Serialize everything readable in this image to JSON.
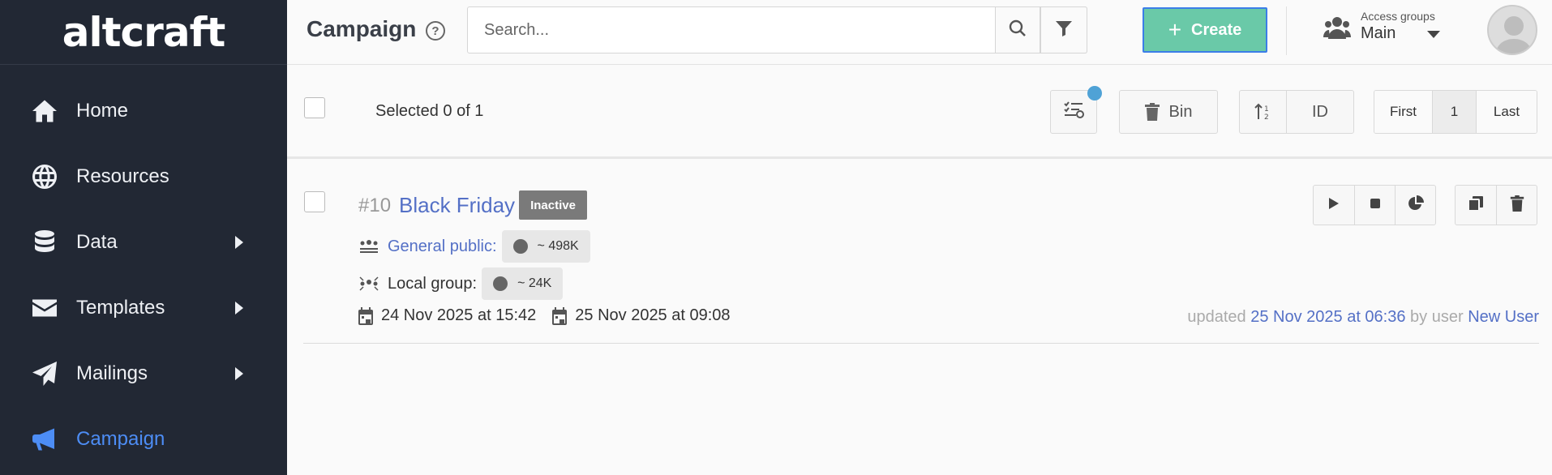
{
  "brand": {
    "logo": "altcraft"
  },
  "sidebar": {
    "items": [
      {
        "label": "Home",
        "icon": "home-icon"
      },
      {
        "label": "Resources",
        "icon": "globe-icon"
      },
      {
        "label": "Data",
        "icon": "database-icon",
        "submenu": true
      },
      {
        "label": "Templates",
        "icon": "envelope-icon",
        "submenu": true
      },
      {
        "label": "Mailings",
        "icon": "paper-plane-icon",
        "submenu": true
      },
      {
        "label": "Campaign",
        "icon": "megaphone-icon",
        "active": true
      }
    ]
  },
  "header": {
    "title": "Campaign",
    "help": "?",
    "search_placeholder": "Search...",
    "create_label": "Create",
    "access": {
      "caption": "Access groups",
      "value": "Main"
    }
  },
  "toolbar": {
    "selected_text": "Selected 0 of 1",
    "bin_label": "Bin",
    "sort_label": "ID",
    "pager": {
      "first": "First",
      "page": "1",
      "last": "Last"
    }
  },
  "campaign": {
    "id": "#10",
    "name": "Black Friday",
    "status": "Inactive",
    "general_label": "General public:",
    "general_count": "~ 498K",
    "local_label": "Local group:",
    "local_count": "~ 24K",
    "start_date": "24 Nov 2025 at 15:42",
    "end_date": "25 Nov 2025 at 09:08",
    "updated_prefix": "updated",
    "updated_date": "25 Nov 2025 at 06:36",
    "updated_by": "by user",
    "updated_user": "New User"
  },
  "colors": {
    "sidebar_bg": "#222834",
    "accent": "#4d8df5",
    "create_bg": "#6ac9a8",
    "link": "#5470c6",
    "badge_bg": "#7a7a7a",
    "notif_dot": "#4fa2d6"
  }
}
